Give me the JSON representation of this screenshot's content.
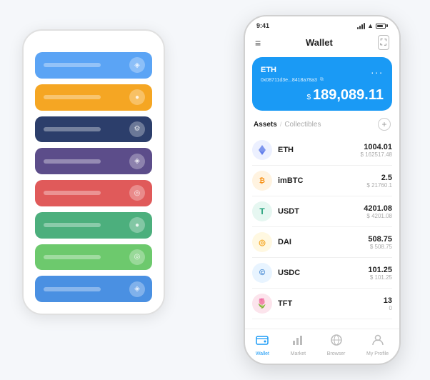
{
  "scene": {
    "background_cards": [
      {
        "color_class": "card-blue-light",
        "icon": "🔵"
      },
      {
        "color_class": "card-orange",
        "icon": "🟠"
      },
      {
        "color_class": "card-dark-navy",
        "icon": "⚙️"
      },
      {
        "color_class": "card-purple",
        "icon": "🔮"
      },
      {
        "color_class": "card-red",
        "icon": "❤️"
      },
      {
        "color_class": "card-green",
        "icon": "🟢"
      },
      {
        "color_class": "card-green-light",
        "icon": "🌿"
      },
      {
        "color_class": "card-blue",
        "icon": "💙"
      }
    ]
  },
  "phone": {
    "status_bar": {
      "time": "9:41",
      "wifi": "WiFi",
      "signal": "Signal"
    },
    "header": {
      "title": "Wallet",
      "menu_label": "≡",
      "scan_label": "⛶"
    },
    "eth_card": {
      "name": "ETH",
      "address": "0x08711d3e...8418a78a3",
      "copy_icon": "⧉",
      "dots": "...",
      "currency_symbol": "$",
      "amount": "189,089.11"
    },
    "assets_section": {
      "tab_active": "Assets",
      "tab_divider": "/",
      "tab_inactive": "Collectibles",
      "add_icon": "+"
    },
    "assets": [
      {
        "icon": "◈",
        "icon_class": "icon-eth",
        "name": "ETH",
        "amount": "1004.01",
        "usd": "$ 162517.48"
      },
      {
        "icon": "⟨BTC⟩",
        "icon_class": "icon-imbtc",
        "name": "imBTC",
        "amount": "2.5",
        "usd": "$ 21760.1"
      },
      {
        "icon": "T",
        "icon_class": "icon-usdt",
        "name": "USDT",
        "amount": "4201.08",
        "usd": "$ 4201.08"
      },
      {
        "icon": "◎",
        "icon_class": "icon-dai",
        "name": "DAI",
        "amount": "508.75",
        "usd": "$ 508.75"
      },
      {
        "icon": "©",
        "icon_class": "icon-usdc",
        "name": "USDC",
        "amount": "101.25",
        "usd": "$ 101.25"
      },
      {
        "icon": "🌷",
        "icon_class": "icon-tft",
        "name": "TFT",
        "amount": "13",
        "usd": "0"
      }
    ],
    "nav": [
      {
        "icon": "◎",
        "label": "Wallet",
        "active": true
      },
      {
        "icon": "📊",
        "label": "Market",
        "active": false
      },
      {
        "icon": "🌐",
        "label": "Browser",
        "active": false
      },
      {
        "icon": "👤",
        "label": "My Profile",
        "active": false
      }
    ]
  }
}
